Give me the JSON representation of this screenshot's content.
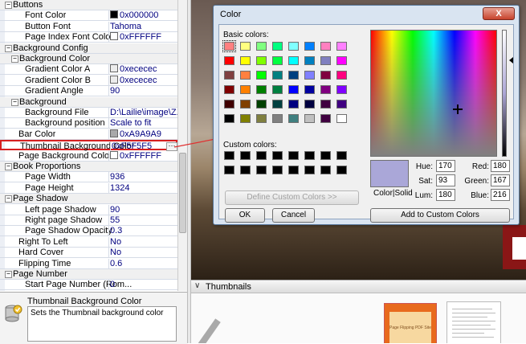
{
  "grid": {
    "rows": [
      {
        "type": "cat",
        "name": "Buttons",
        "indent": 0
      },
      {
        "name": "Font Color",
        "value": "0x000000",
        "swatch": "#000000",
        "indent": 2
      },
      {
        "name": "Button Font",
        "value": "Tahoma",
        "indent": 2
      },
      {
        "name": "Page Index Font Color",
        "value": "0xFFFFFF",
        "swatch": "#FFFFFF",
        "indent": 2
      },
      {
        "type": "cat",
        "name": "Background Config",
        "indent": 0
      },
      {
        "type": "cat",
        "name": "Background Color",
        "indent": 1
      },
      {
        "name": "Gradient Color A",
        "value": "0xececec",
        "swatch": "#ececec",
        "indent": 2
      },
      {
        "name": "Gradient Color B",
        "value": "0xececec",
        "swatch": "#ececec",
        "indent": 2
      },
      {
        "name": "Gradient Angle",
        "value": "90",
        "indent": 2
      },
      {
        "type": "cat",
        "name": "Background",
        "indent": 1
      },
      {
        "name": "Background File",
        "value": "D:\\Lailie\\image\\Z...",
        "indent": 2
      },
      {
        "name": "Background position",
        "value": "Scale to fit",
        "indent": 2
      },
      {
        "name": "Bar Color",
        "value": "0xA9A9A9",
        "swatch": "#A9A9A9",
        "indent": 1
      },
      {
        "name": "Thumbnail Background Color",
        "value": "0xF5F5F5",
        "indent": 1,
        "selected": true
      },
      {
        "name": "Page Background Color",
        "value": "0xFFFFFF",
        "swatch": "#FFFFFF",
        "indent": 1
      },
      {
        "type": "cat",
        "name": "Book Proportions",
        "indent": 0
      },
      {
        "name": "Page Width",
        "value": "936",
        "indent": 2
      },
      {
        "name": "Page Height",
        "value": "1324",
        "indent": 2
      },
      {
        "type": "cat",
        "name": "Page Shadow",
        "indent": 0
      },
      {
        "name": "Left page Shadow",
        "value": "90",
        "indent": 2
      },
      {
        "name": "Right page Shadow",
        "value": "55",
        "indent": 2
      },
      {
        "name": "Page Shadow Opacity",
        "value": "0.3",
        "indent": 2
      },
      {
        "name": "Right To Left",
        "value": "No",
        "indent": 1
      },
      {
        "name": "Hard Cover",
        "value": "No",
        "indent": 1
      },
      {
        "name": "Flipping Time",
        "value": "0.6",
        "indent": 1
      },
      {
        "type": "cat",
        "name": "Page Number",
        "indent": 0
      },
      {
        "name": "Start Page Number (Rom...",
        "value": "0",
        "indent": 2
      }
    ]
  },
  "desc": {
    "title": "Thumbnail Background Color",
    "text": "Sets the Thumbnail background color"
  },
  "thumbs": {
    "label": "Thumbnails",
    "thumb1_text": "Page Flipping PDF Site"
  },
  "dialog": {
    "title": "Color",
    "close": "X",
    "basic_label": "Basic colors:",
    "custom_label": "Custom colors:",
    "define_btn": "Define Custom Colors >>",
    "ok_btn": "OK",
    "cancel_btn": "Cancel",
    "add_btn": "Add to Custom Colors",
    "solid_label": "Color|Solid",
    "basic_colors": [
      "#FF8080",
      "#FFFF80",
      "#80FF80",
      "#00FF80",
      "#80FFFF",
      "#0080FF",
      "#FF80C0",
      "#FF80FF",
      "#FF0000",
      "#FFFF00",
      "#80FF00",
      "#00FF40",
      "#00FFFF",
      "#0080C0",
      "#8080C0",
      "#FF00FF",
      "#804040",
      "#FF8040",
      "#00FF00",
      "#008080",
      "#004080",
      "#8080FF",
      "#800040",
      "#FF0080",
      "#800000",
      "#FF8000",
      "#008000",
      "#008040",
      "#0000FF",
      "#0000A0",
      "#800080",
      "#8000FF",
      "#400000",
      "#804000",
      "#004000",
      "#004040",
      "#000080",
      "#000040",
      "#400040",
      "#400080",
      "#000000",
      "#808000",
      "#808040",
      "#808080",
      "#408080",
      "#C0C0C0",
      "#400040",
      "#FFFFFF"
    ],
    "custom_colors": [
      "#000000",
      "#000000",
      "#000000",
      "#000000",
      "#000000",
      "#000000",
      "#000000",
      "#000000",
      "#000000",
      "#000000",
      "#000000",
      "#000000",
      "#000000",
      "#000000",
      "#000000",
      "#000000"
    ],
    "selected_color": "#AAA7D8",
    "fields": {
      "hue_label": "Hue:",
      "hue": "170",
      "sat_label": "Sat:",
      "sat": "93",
      "lum_label": "Lum:",
      "lum": "180",
      "red_label": "Red:",
      "red": "180",
      "green_label": "Green:",
      "green": "167",
      "blue_label": "Blue:",
      "blue": "216"
    }
  },
  "colors": {
    "highlight": "#D62020",
    "arrow": "#E03030"
  }
}
